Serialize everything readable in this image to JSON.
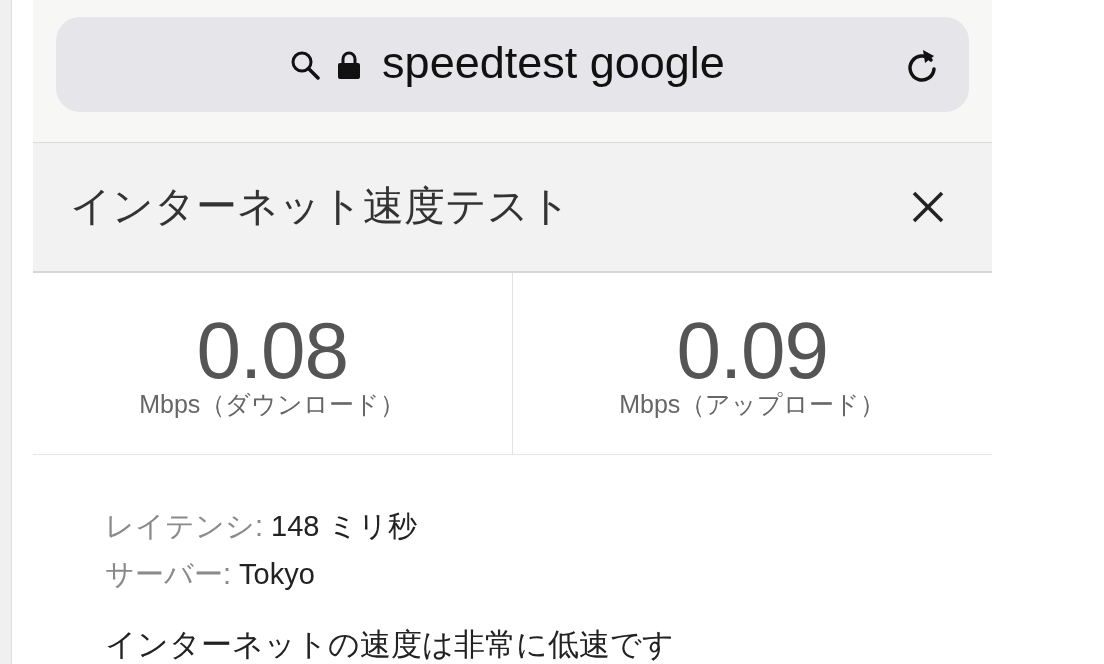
{
  "address_bar": {
    "url": "speedtest google"
  },
  "panel": {
    "title": "インターネット速度テスト"
  },
  "results": [
    {
      "value": "0.08",
      "unit": "Mbps（ダウンロード）"
    },
    {
      "value": "0.09",
      "unit": "Mbps（アップロード）"
    }
  ],
  "details": [
    {
      "label": "レイテンシ:",
      "value": "148 ミリ秒"
    },
    {
      "label": "サーバー:",
      "value": "Tokyo"
    }
  ],
  "summary": "インターネットの速度は非常に低速です"
}
